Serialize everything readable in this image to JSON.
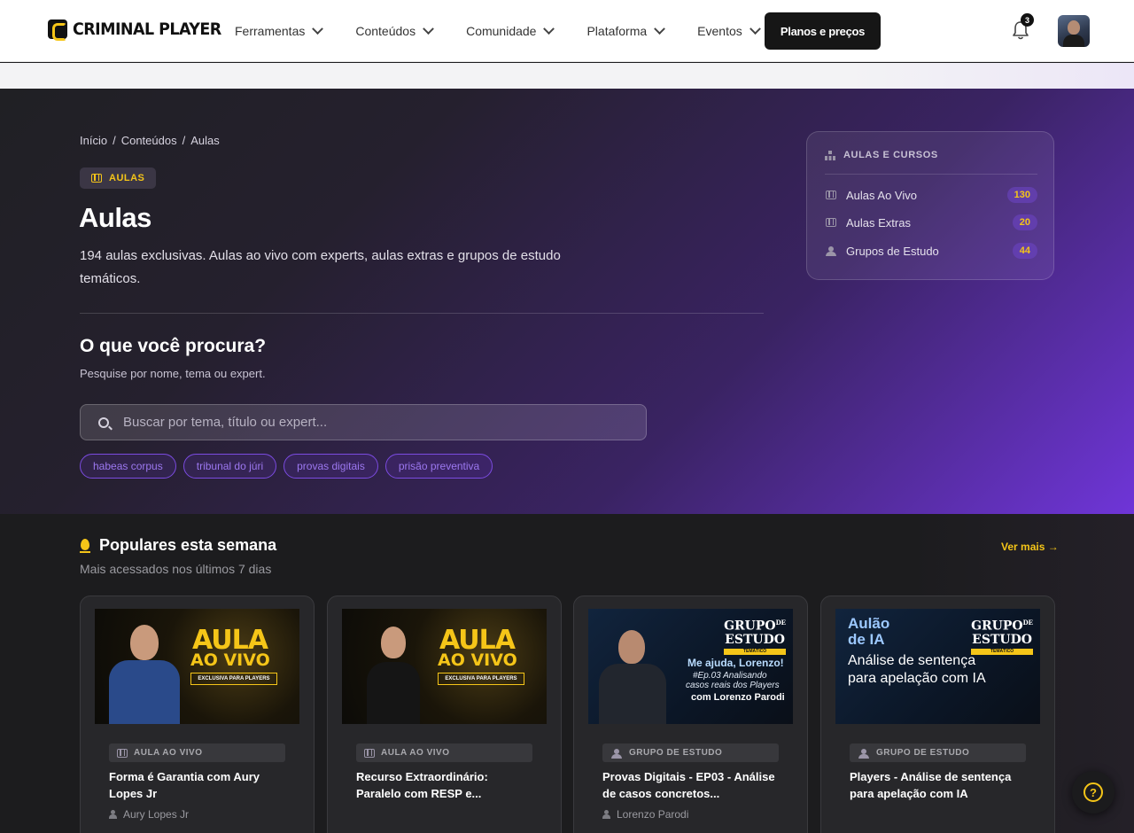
{
  "header": {
    "logo": "CRIMINAL PLAYER",
    "nav": [
      "Ferramentas",
      "Conteúdos",
      "Comunidade",
      "Plataforma",
      "Eventos"
    ],
    "plans_button": "Planos e preços",
    "notifications_count": "3",
    "icons": [
      "bell-icon",
      "avatar"
    ]
  },
  "hero": {
    "breadcrumb": [
      "Início",
      "/",
      "Conteúdos",
      "/",
      "Aulas"
    ],
    "tag": "AULAS",
    "title": "Aulas",
    "description": "194 aulas exclusivas. Aulas ao vivo com experts, aulas extras e grupos de estudo temáticos.",
    "search_title": "O que você procura?",
    "search_subtitle": "Pesquise por nome, tema ou expert.",
    "search_placeholder": "Buscar por tema, título ou expert...",
    "chips": [
      "habeas corpus",
      "tribunal do júri",
      "provas digitais",
      "prisão preventiva"
    ]
  },
  "sidebar": {
    "heading": "AULAS E CURSOS",
    "items": [
      {
        "label": "Aulas Ao Vivo",
        "count": "130",
        "icon": "film-icon"
      },
      {
        "label": "Aulas Extras",
        "count": "20",
        "icon": "film-icon"
      },
      {
        "label": "Grupos de Estudo",
        "count": "44",
        "icon": "users-icon"
      }
    ]
  },
  "popular": {
    "title": "Populares esta semana",
    "subtitle": "Mais acessados nos últimos 7 dias",
    "see_more": "Ver mais →",
    "cards": [
      {
        "thumb_line1": "AULA",
        "thumb_line2": "AO VIVO",
        "thumb_badge": "EXCLUSIVA PARA PLAYERS",
        "tag": "AULA AO VIVO",
        "title": "Forma é Garantia com Aury Lopes Jr",
        "author": "Aury Lopes Jr"
      },
      {
        "thumb_line1": "AULA",
        "thumb_line2": "AO VIVO",
        "thumb_badge": "EXCLUSIVA PARA PLAYERS",
        "tag": "AULA AO VIVO",
        "title": "Recurso Extraordinário: Paralelo com RESP e...",
        "author": ""
      },
      {
        "thumb_logo1": "GRUPO",
        "thumb_logo_de": "DE",
        "thumb_logo2": "ESTUDO",
        "thumb_logo_tag": "TEMÁTICO",
        "thumb_text1": "Me ajuda, Lorenzo!",
        "thumb_text2": "#Ep.03 Analisando",
        "thumb_text3": "casos reais dos Players",
        "thumb_text4": "com Lorenzo Parodi",
        "tag": "GRUPO DE ESTUDO",
        "title": "Provas Digitais - EP03 - Análise de casos concretos...",
        "author": "Lorenzo Parodi"
      },
      {
        "thumb_logo1": "GRUPO",
        "thumb_logo_de": "DE",
        "thumb_logo2": "ESTUDO",
        "thumb_logo_tag": "TEMÁTICO",
        "thumb_text1": "Aulão",
        "thumb_text2": "de IA",
        "thumb_text3": "Análise de sentença",
        "thumb_text4": "para apelação com IA",
        "tag": "GRUPO DE ESTUDO",
        "title": "Players - Análise de sentença para apelação com IA",
        "author": ""
      }
    ]
  },
  "help_button": "?",
  "colors": {
    "accent": "#f5c518",
    "purple": "#6f35d8",
    "dark": "#1c1c1e"
  }
}
